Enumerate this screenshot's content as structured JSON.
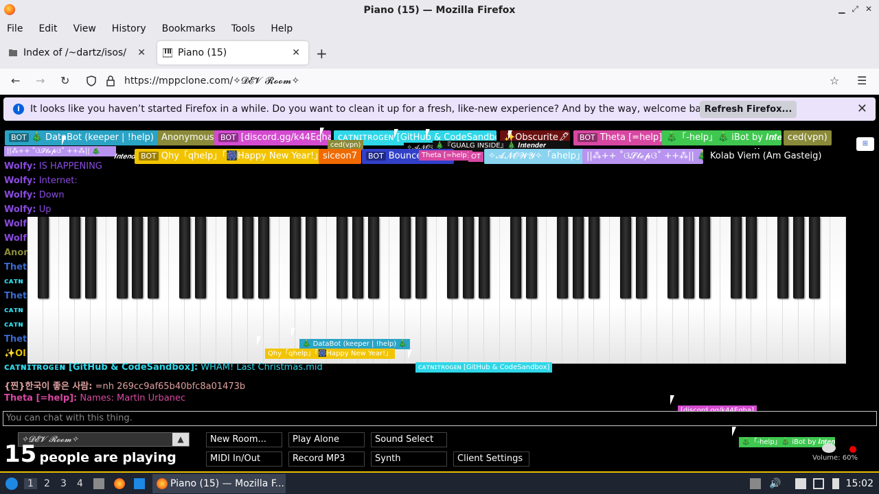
{
  "window": {
    "title": "Piano (15) — Mozilla Firefox"
  },
  "menu": [
    "File",
    "Edit",
    "View",
    "History",
    "Bookmarks",
    "Tools",
    "Help"
  ],
  "tabs": [
    {
      "label": "Index of /~dartz/isos/"
    },
    {
      "label": "Piano (15)"
    }
  ],
  "url": "https://mppclone.com/✧𝓓𝓔𝓥 𝓡𝓸𝓸𝓶✧",
  "notification": {
    "message": "It looks like you haven’t started Firefox in a while. Do you want to clean it up for a fresh, like-new experience? And by the way, welcome back!",
    "button": "Refresh Firefox..."
  },
  "users_row1": [
    {
      "bot": "BOT",
      "name": "🎄 DataBot (keeper | !help) 🎄",
      "bg": "#2aa3c5",
      "fg": "#fff"
    },
    {
      "name": "Anonymous",
      "bg": "#8a8a3a",
      "fg": "#fff"
    },
    {
      "bot": "BOT",
      "name": "[discord.gg/k44Eqha]",
      "bg": "#d44bd0",
      "fg": "#fff"
    },
    {
      "name": "ᴄᴀᴛɴɪᴛʀᴏɢᴇɴ [GitHub & CodeSandbox]",
      "bg": "#2fd7e8",
      "fg": "#fff"
    },
    {
      "name": "✨Obscurite🖋💀",
      "bg": "#6a1010",
      "fg": "#fff"
    },
    {
      "bot": "BOT",
      "name": "Theta [=help]",
      "bg": "#d848a2",
      "fg": "#fff"
    },
    {
      "name": "🎄「-help」🎄 iBot by 𝑰𝒏𝒕𝒆𝒏𝒅𝒆𝒓",
      "bg": "#3fc750",
      "fg": "#fff"
    },
    {
      "name": "ced(vpn)",
      "bg": "#8a8a3a",
      "fg": "#fff"
    }
  ],
  "users_row2": [
    {
      "bot": "BOT",
      "name": "Qhy「qhelp」「🎆Happy New Year!」",
      "bg": "#f2c400",
      "fg": "#fff"
    },
    {
      "name": "siceon7",
      "bg": "#f06a00",
      "fg": "#fff"
    },
    {
      "bot": "BOT",
      "name": "Bouncer",
      "bg": "#3240c8",
      "fg": "#fff"
    },
    {
      "bot": "BOT",
      "name": "✧𝓐𝓝𝓞𝓦𝓨✧「ahelp」",
      "bg": "#8ad4f0",
      "fg": "#fff"
    },
    {
      "name": "||⁂++ ˚ଓ𝓢𝓽𝓮𝓹ଓ˚ ++⁂|| 🎄",
      "bg": "#b894f0",
      "fg": "#fff"
    },
    {
      "name": "Kolab Viem (Am Gasteig)",
      "bg": "#000",
      "fg": "#fff"
    }
  ],
  "overlap_fragments": {
    "stepper": "||⁂++ ˚ଓ𝓢𝓽𝓮𝓹ଓ˚ ++⁂|| 🎄",
    "intender": "𝑰𝒏𝒕𝒆𝒏𝒅𝒆𝒓",
    "ced": "ced(vpn)",
    "gualg": "🎄『GUALG INSIDE』🎄 𝑰𝒏𝒕𝒆𝒏𝒅𝒆𝒓",
    "anowy_short": "✧𝓐𝓝𝓞𝓦",
    "theta": "Theta [=help]",
    "ot": "OT",
    "me": "Me"
  },
  "chat": [
    {
      "name": "Wolfy:",
      "msg": "IS HAPPENING",
      "color": "#8a4be0"
    },
    {
      "name": "Wolfy:",
      "msg": "Internet:",
      "color": "#8a4be0"
    },
    {
      "name": "Wolfy:",
      "msg": "Down",
      "color": "#8a4be0"
    },
    {
      "name": "Wolfy:",
      "msg": "Up",
      "color": "#8a4be0"
    }
  ],
  "chat_fragments": [
    "Wolf",
    "Wolf",
    "Anon",
    "Thet",
    "ᴄᴀᴛɴ",
    "Thet",
    "ᴄᴀᴛɴ",
    "ᴄᴀᴛɴ",
    "Thet",
    "✨Ol"
  ],
  "chat_bottom": [
    {
      "name": "ᴄᴀᴛɴɪᴛʀᴏɢᴇɴ [GitHub & CodeSandbox]:",
      "msg": "WHAM! Last Christmas.mid",
      "color": "#2fd7e8"
    },
    {
      "name": "{찐}한국이 좋은 사람:",
      "msg": "=nh 269cc9af65b40bfc8a01473b",
      "color": "#e0a0a0"
    },
    {
      "name": "Theta [=help]:",
      "msg": "Names: Martin Urbanec",
      "color": "#d848a2"
    }
  ],
  "floating": {
    "databot": "🎄 DataBot (keeper | !help) 🎄",
    "qhy": "Qhy「qhelp」「🎆Happy New Year!」",
    "catnitrogen": "ᴄᴀᴛɴɪᴛʀᴏɢᴇɴ [GitHub & CodeSandbox]",
    "discord": "[discord.gg/k44Eqha]",
    "ibot": "🎄「-help」🎄 iBot by 𝑰𝒏𝒕𝒆𝒏𝒅𝒆𝒓"
  },
  "chat_placeholder": "You can chat with this thing.",
  "room": "✧𝓓𝓔𝓥 𝓡𝓸𝓸𝓶✧",
  "playing": {
    "count": "15",
    "text": "people are playing"
  },
  "buttons_row1": [
    "New Room...",
    "Play Alone",
    "Sound Select"
  ],
  "buttons_row2": [
    "MIDI In/Out",
    "Record MP3",
    "Synth",
    "Client Settings"
  ],
  "volume": "Volume: 60%",
  "taskbar": {
    "workspaces": [
      "1",
      "2",
      "3",
      "4"
    ],
    "window": "Piano (15) — Mozilla F...",
    "clock": "15:02"
  }
}
